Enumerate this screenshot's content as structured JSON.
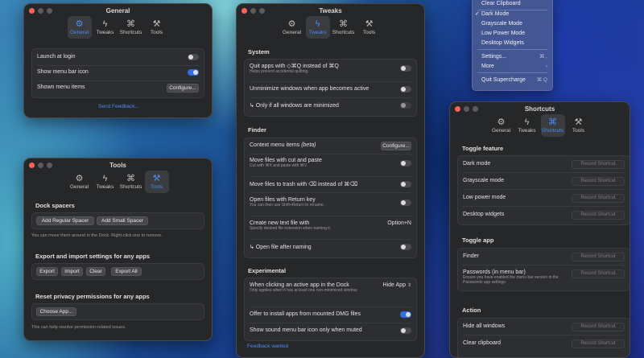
{
  "menu": {
    "items": [
      {
        "label": "Clear Clipboard",
        "shortcut": "",
        "checked": false
      },
      {
        "label": "Dark Mode",
        "shortcut": "",
        "checked": true
      },
      {
        "label": "Grayscale Mode",
        "shortcut": "",
        "checked": false
      },
      {
        "label": "Low Power Mode",
        "shortcut": "",
        "checked": false
      },
      {
        "label": "Desktop Widgets",
        "shortcut": "",
        "checked": false
      },
      {
        "label": "Settings...",
        "shortcut": "⌘ ,",
        "checked": false
      },
      {
        "label": "More",
        "shortcut": "›",
        "checked": false
      },
      {
        "label": "Quit Supercharge",
        "shortcut": "⌘ Q",
        "checked": false
      }
    ],
    "checkmark": "✓"
  },
  "tabs": {
    "general": "General",
    "tweaks": "Tweaks",
    "shortcuts": "Shortcuts",
    "tools": "Tools"
  },
  "general_window": {
    "title": "General",
    "launch_at_login": "Launch at login",
    "show_menu_bar_icon": "Show menu bar icon",
    "shown_menu_items": "Shown menu items",
    "configure": "Configure...",
    "send_feedback": "Send Feedback...",
    "toggles": {
      "launch_at_login": false,
      "show_menu_bar_icon": true
    }
  },
  "tools_window": {
    "title": "Tools",
    "dock_spacers_title": "Dock spacers",
    "add_regular_spacer": "Add Regular Spacer",
    "add_small_spacer": "Add Small Spacer",
    "dock_note": "You can move them around in the Dock. Right-click one to remove.",
    "export_title": "Export and import settings for any apps",
    "export": "Export",
    "import": "Import",
    "clear": "Clear",
    "export_all": "Export All",
    "privacy_title": "Reset privacy permissions for any apps",
    "choose_app": "Choose App...",
    "privacy_note": "This can help resolve permission-related issues."
  },
  "tweaks_window": {
    "title": "Tweaks",
    "system_title": "System",
    "quit_apps": "Quit apps with ◇⌘Q instead of ⌘Q",
    "quit_apps_sub": "Helps prevent accidental quitting.",
    "unminimize": "Unminimize windows when app becomes active",
    "only_if_min": "↳ Only if all windows are minimized",
    "finder_title": "Finder",
    "context_menu": "Context menu items",
    "context_menu_beta": "(beta)",
    "configure": "Configure...",
    "move_files": "Move files with cut and paste",
    "move_files_sub": "Cut with ⌘X and paste with ⌘V.",
    "move_trash": "Move files to trash with ⌫ instead of ⌘⌫",
    "open_return": "Open files with Return key",
    "open_return_sub": "You can then use Shift+Return to rename.",
    "new_text": "Create new text file with",
    "new_text_sub": "Specify desired file extension when naming it.",
    "new_text_value": "Option+N",
    "open_after": "↳ Open file after naming",
    "experimental_title": "Experimental",
    "click_active": "When clicking an active app in the Dock",
    "click_active_sub": "Only applies when it has at least one non-minimized window.",
    "click_active_value": "Hide App",
    "offer_install": "Offer to install apps from mounted DMG files",
    "sound_menu": "Show sound menu bar icon only when muted",
    "feedback": "Feedback wanted",
    "toggles": {
      "quit_apps": false,
      "unminimize": false,
      "only_if_min": false,
      "move_files": false,
      "move_trash": false,
      "open_return": false,
      "open_after": false,
      "offer_install": true,
      "sound_menu": false
    }
  },
  "shortcuts_window": {
    "title": "Shortcuts",
    "toggle_feature_title": "Toggle feature",
    "features": [
      "Dark mode",
      "Grayscale mode",
      "Low power mode",
      "Desktop widgets"
    ],
    "toggle_app_title": "Toggle app",
    "finder": "Finder",
    "passwords": "Passwords (in menu bar)",
    "passwords_sub": "Ensure you have enabled the menu bar version in the Passwords app settings.",
    "action_title": "Action",
    "actions": [
      "Hide all windows",
      "Clear clipboard"
    ],
    "record": "Record Shortcut"
  },
  "colors": {
    "accent": "#4a8bf5",
    "window_bg": "#262729",
    "close_button": "#fe5f57"
  }
}
